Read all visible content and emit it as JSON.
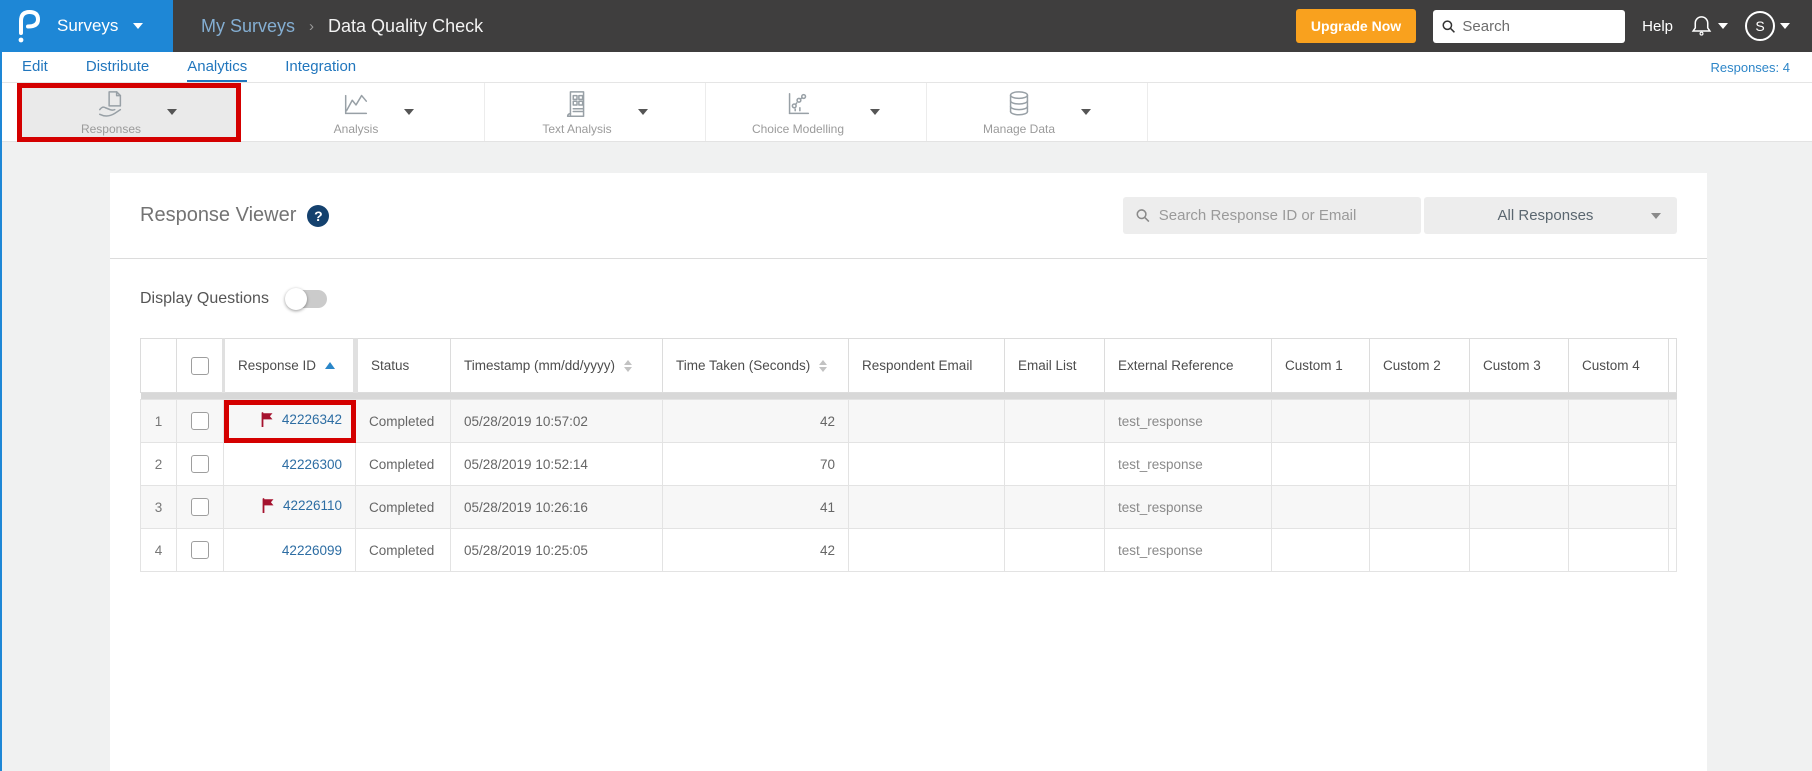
{
  "topbar": {
    "product": "Surveys",
    "breadcrumb": {
      "parent": "My Surveys",
      "separator": "›",
      "current": "Data Quality Check"
    },
    "upgrade_label": "Upgrade Now",
    "search_placeholder": "Search",
    "help_label": "Help",
    "avatar_initial": "S"
  },
  "tabs": {
    "items": [
      {
        "label": "Edit"
      },
      {
        "label": "Distribute"
      },
      {
        "label": "Analytics",
        "active": true
      },
      {
        "label": "Integration"
      }
    ],
    "responses_count": "Responses: 4"
  },
  "toolbar": {
    "items": [
      {
        "label": "Responses",
        "icon": "hand-document-icon",
        "highlighted": true
      },
      {
        "label": "Analysis",
        "icon": "line-chart-icon"
      },
      {
        "label": "Text Analysis",
        "icon": "text-document-icon"
      },
      {
        "label": "Choice Modelling",
        "icon": "dot-plot-icon"
      },
      {
        "label": "Manage Data",
        "icon": "database-icon"
      }
    ]
  },
  "viewer": {
    "title": "Response Viewer",
    "help_glyph": "?",
    "search_placeholder": "Search Response ID or Email",
    "filter_selected": "All Responses",
    "display_questions_label": "Display Questions",
    "display_questions_on": false
  },
  "table": {
    "headers": [
      {
        "key": "row_num",
        "label": ""
      },
      {
        "key": "select",
        "label": "",
        "type": "checkbox"
      },
      {
        "key": "response_id",
        "label": "Response ID",
        "sort": "asc"
      },
      {
        "key": "status",
        "label": "Status"
      },
      {
        "key": "timestamp",
        "label": "Timestamp (mm/dd/yyyy)",
        "sort": "both"
      },
      {
        "key": "time_taken",
        "label": "Time Taken (Seconds)",
        "sort": "both"
      },
      {
        "key": "respondent_email",
        "label": "Respondent Email"
      },
      {
        "key": "email_list",
        "label": "Email List"
      },
      {
        "key": "external_reference",
        "label": "External Reference"
      },
      {
        "key": "custom1",
        "label": "Custom 1"
      },
      {
        "key": "custom2",
        "label": "Custom 2"
      },
      {
        "key": "custom3",
        "label": "Custom 3"
      },
      {
        "key": "custom4",
        "label": "Custom 4"
      }
    ],
    "rows": [
      {
        "row_num": "1",
        "flagged": true,
        "annotated": true,
        "response_id": "42226342",
        "status": "Completed",
        "timestamp": "05/28/2019 10:57:02",
        "time_taken": "42",
        "respondent_email": "",
        "email_list": "",
        "external_reference": "test_response",
        "custom1": "",
        "custom2": "",
        "custom3": "",
        "custom4": ""
      },
      {
        "row_num": "2",
        "flagged": false,
        "annotated": false,
        "response_id": "42226300",
        "status": "Completed",
        "timestamp": "05/28/2019 10:52:14",
        "time_taken": "70",
        "respondent_email": "",
        "email_list": "",
        "external_reference": "test_response",
        "custom1": "",
        "custom2": "",
        "custom3": "",
        "custom4": ""
      },
      {
        "row_num": "3",
        "flagged": true,
        "annotated": false,
        "response_id": "42226110",
        "status": "Completed",
        "timestamp": "05/28/2019 10:26:16",
        "time_taken": "41",
        "respondent_email": "",
        "email_list": "",
        "external_reference": "test_response",
        "custom1": "",
        "custom2": "",
        "custom3": "",
        "custom4": ""
      },
      {
        "row_num": "4",
        "flagged": false,
        "annotated": false,
        "response_id": "42226099",
        "status": "Completed",
        "timestamp": "05/28/2019 10:25:05",
        "time_taken": "42",
        "respondent_email": "",
        "email_list": "",
        "external_reference": "test_response",
        "custom1": "",
        "custom2": "",
        "custom3": "",
        "custom4": ""
      }
    ]
  },
  "colors": {
    "brand_blue": "#1e87d6",
    "topbar_dark": "#3f3e3e",
    "upgrade_orange": "#f9a11e",
    "tab_blue": "#2176bd",
    "link_blue": "#2d6da3",
    "annotation_red": "#d40000",
    "flag_red": "#a5122e"
  }
}
